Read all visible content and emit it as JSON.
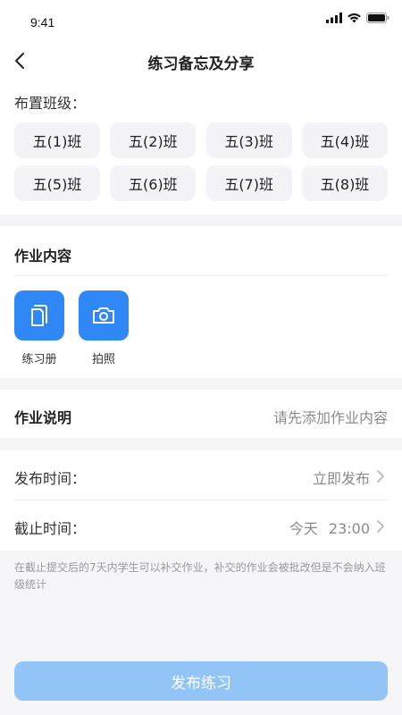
{
  "status_bar": {
    "time": "9:41"
  },
  "nav": {
    "title": "练习备忘及分享"
  },
  "classes": {
    "label": "布置班级：",
    "items": [
      "五(1)班",
      "五(2)班",
      "五(3)班",
      "五(4)班",
      "五(5)班",
      "五(6)班",
      "五(7)班",
      "五(8)班"
    ]
  },
  "homework": {
    "title": "作业内容",
    "items": [
      {
        "label": "练习册",
        "icon": "workbook-icon"
      },
      {
        "label": "拍照",
        "icon": "camera-icon"
      }
    ]
  },
  "description": {
    "label": "作业说明",
    "placeholder": "请先添加作业内容"
  },
  "publish_time": {
    "label": "发布时间：",
    "value": "立即发布"
  },
  "deadline": {
    "label": "截止时间：",
    "day": "今天",
    "time": "23:00"
  },
  "note": "在截止提交后的7天内学生可以补交作业，补交的作业会被批改但是不会纳入班级统计",
  "submit": {
    "label": "发布练习"
  },
  "colors": {
    "accent": "#2f88f5",
    "button_disabled": "#93c4f7"
  }
}
